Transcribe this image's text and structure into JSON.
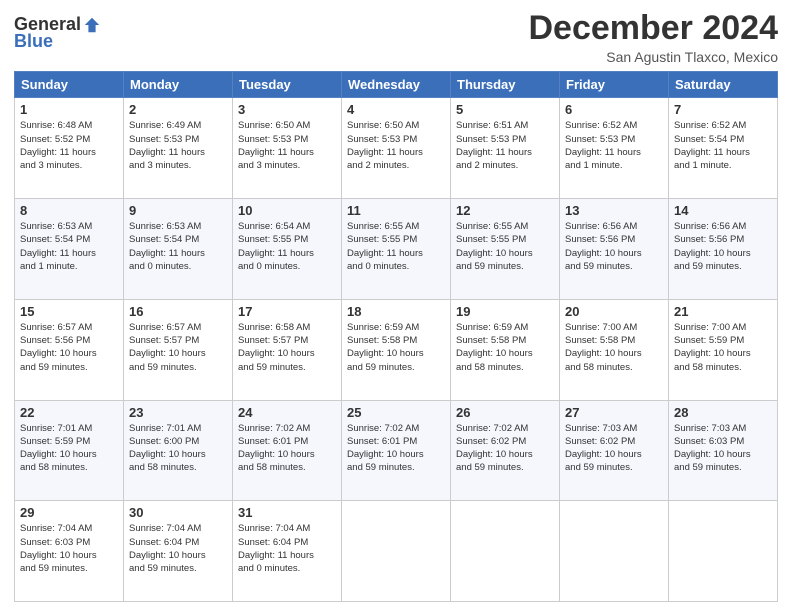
{
  "logo": {
    "general": "General",
    "blue": "Blue"
  },
  "title": "December 2024",
  "location": "San Agustin Tlaxco, Mexico",
  "weekdays": [
    "Sunday",
    "Monday",
    "Tuesday",
    "Wednesday",
    "Thursday",
    "Friday",
    "Saturday"
  ],
  "weeks": [
    [
      {
        "day": "1",
        "info": "Sunrise: 6:48 AM\nSunset: 5:52 PM\nDaylight: 11 hours\nand 3 minutes."
      },
      {
        "day": "2",
        "info": "Sunrise: 6:49 AM\nSunset: 5:53 PM\nDaylight: 11 hours\nand 3 minutes."
      },
      {
        "day": "3",
        "info": "Sunrise: 6:50 AM\nSunset: 5:53 PM\nDaylight: 11 hours\nand 3 minutes."
      },
      {
        "day": "4",
        "info": "Sunrise: 6:50 AM\nSunset: 5:53 PM\nDaylight: 11 hours\nand 2 minutes."
      },
      {
        "day": "5",
        "info": "Sunrise: 6:51 AM\nSunset: 5:53 PM\nDaylight: 11 hours\nand 2 minutes."
      },
      {
        "day": "6",
        "info": "Sunrise: 6:52 AM\nSunset: 5:53 PM\nDaylight: 11 hours\nand 1 minute."
      },
      {
        "day": "7",
        "info": "Sunrise: 6:52 AM\nSunset: 5:54 PM\nDaylight: 11 hours\nand 1 minute."
      }
    ],
    [
      {
        "day": "8",
        "info": "Sunrise: 6:53 AM\nSunset: 5:54 PM\nDaylight: 11 hours\nand 1 minute."
      },
      {
        "day": "9",
        "info": "Sunrise: 6:53 AM\nSunset: 5:54 PM\nDaylight: 11 hours\nand 0 minutes."
      },
      {
        "day": "10",
        "info": "Sunrise: 6:54 AM\nSunset: 5:55 PM\nDaylight: 11 hours\nand 0 minutes."
      },
      {
        "day": "11",
        "info": "Sunrise: 6:55 AM\nSunset: 5:55 PM\nDaylight: 11 hours\nand 0 minutes."
      },
      {
        "day": "12",
        "info": "Sunrise: 6:55 AM\nSunset: 5:55 PM\nDaylight: 10 hours\nand 59 minutes."
      },
      {
        "day": "13",
        "info": "Sunrise: 6:56 AM\nSunset: 5:56 PM\nDaylight: 10 hours\nand 59 minutes."
      },
      {
        "day": "14",
        "info": "Sunrise: 6:56 AM\nSunset: 5:56 PM\nDaylight: 10 hours\nand 59 minutes."
      }
    ],
    [
      {
        "day": "15",
        "info": "Sunrise: 6:57 AM\nSunset: 5:56 PM\nDaylight: 10 hours\nand 59 minutes."
      },
      {
        "day": "16",
        "info": "Sunrise: 6:57 AM\nSunset: 5:57 PM\nDaylight: 10 hours\nand 59 minutes."
      },
      {
        "day": "17",
        "info": "Sunrise: 6:58 AM\nSunset: 5:57 PM\nDaylight: 10 hours\nand 59 minutes."
      },
      {
        "day": "18",
        "info": "Sunrise: 6:59 AM\nSunset: 5:58 PM\nDaylight: 10 hours\nand 59 minutes."
      },
      {
        "day": "19",
        "info": "Sunrise: 6:59 AM\nSunset: 5:58 PM\nDaylight: 10 hours\nand 58 minutes."
      },
      {
        "day": "20",
        "info": "Sunrise: 7:00 AM\nSunset: 5:58 PM\nDaylight: 10 hours\nand 58 minutes."
      },
      {
        "day": "21",
        "info": "Sunrise: 7:00 AM\nSunset: 5:59 PM\nDaylight: 10 hours\nand 58 minutes."
      }
    ],
    [
      {
        "day": "22",
        "info": "Sunrise: 7:01 AM\nSunset: 5:59 PM\nDaylight: 10 hours\nand 58 minutes."
      },
      {
        "day": "23",
        "info": "Sunrise: 7:01 AM\nSunset: 6:00 PM\nDaylight: 10 hours\nand 58 minutes."
      },
      {
        "day": "24",
        "info": "Sunrise: 7:02 AM\nSunset: 6:01 PM\nDaylight: 10 hours\nand 58 minutes."
      },
      {
        "day": "25",
        "info": "Sunrise: 7:02 AM\nSunset: 6:01 PM\nDaylight: 10 hours\nand 59 minutes."
      },
      {
        "day": "26",
        "info": "Sunrise: 7:02 AM\nSunset: 6:02 PM\nDaylight: 10 hours\nand 59 minutes."
      },
      {
        "day": "27",
        "info": "Sunrise: 7:03 AM\nSunset: 6:02 PM\nDaylight: 10 hours\nand 59 minutes."
      },
      {
        "day": "28",
        "info": "Sunrise: 7:03 AM\nSunset: 6:03 PM\nDaylight: 10 hours\nand 59 minutes."
      }
    ],
    [
      {
        "day": "29",
        "info": "Sunrise: 7:04 AM\nSunset: 6:03 PM\nDaylight: 10 hours\nand 59 minutes."
      },
      {
        "day": "30",
        "info": "Sunrise: 7:04 AM\nSunset: 6:04 PM\nDaylight: 10 hours\nand 59 minutes."
      },
      {
        "day": "31",
        "info": "Sunrise: 7:04 AM\nSunset: 6:04 PM\nDaylight: 11 hours\nand 0 minutes."
      },
      null,
      null,
      null,
      null
    ]
  ]
}
